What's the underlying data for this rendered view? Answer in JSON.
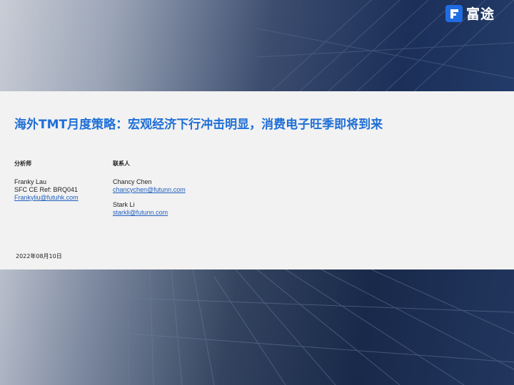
{
  "logo": {
    "text": "富途"
  },
  "report": {
    "title": "海外TMT月度策略：宏观经济下行冲击明显，消费电子旺季即将到来",
    "date": "2022年08月10日"
  },
  "analyst": {
    "heading": "分析师",
    "name": "Franky Lau",
    "ref": "SFC CE Ref: BRQ041",
    "email": "Frankyliu@futuhk.com"
  },
  "contacts": {
    "heading": "联系人",
    "items": [
      {
        "name": "Chancy Chen",
        "email": "chancychen@futunn.com"
      },
      {
        "name": "Stark Li",
        "email": "starkli@futunn.com"
      }
    ]
  },
  "colors": {
    "title_blue": "#1f6fd6",
    "link_blue": "#1f5fbf",
    "logo_blue": "#1f6ce3"
  }
}
